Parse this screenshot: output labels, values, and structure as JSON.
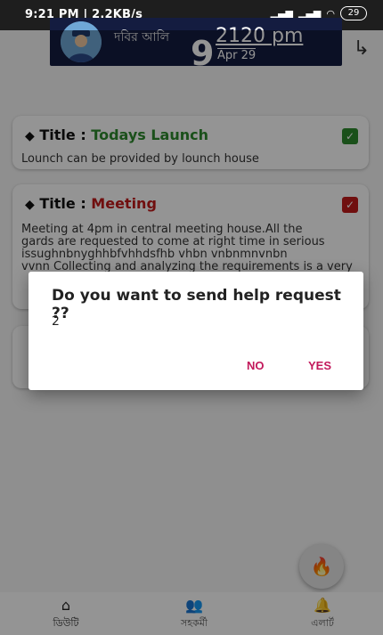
{
  "status_bar": {
    "time_network": "9:21 PM | 2.2KB/s",
    "battery": "29"
  },
  "header": {
    "guard_name": "দবির আলি",
    "big_number": "9",
    "time": "2120 pm",
    "date": "Apr 29"
  },
  "cards": [
    {
      "title_label": "Title :",
      "title_value": "Todays Launch",
      "description": "Lounch can be provided by lounch house",
      "status_color": "#2e8b2e"
    },
    {
      "title_label": "Title :",
      "title_value": "Meeting",
      "description_lines": [
        "Meeting at 4pm in central meeting house.All the",
        "gards are requested to come at right time in serious",
        "issughnbnyghhbfvhhdsfhb vhbn vnbnmnvnbn",
        "vvnn Collecting and analyzing the requirements is a very"
      ],
      "status_color": "#c21a1a"
    }
  ],
  "dialog": {
    "title": "Do you want to send help request ??",
    "message": "2",
    "no_label": "NO",
    "yes_label": "YES"
  },
  "nav": {
    "items": [
      {
        "label": "ডিউটি",
        "icon": "home-icon"
      },
      {
        "label": "সহকর্মী",
        "icon": "people-icon"
      },
      {
        "label": "এলার্ট",
        "icon": "bell-icon"
      }
    ]
  },
  "colors": {
    "accent": "#c2185b",
    "header_bg": "#141c40"
  }
}
